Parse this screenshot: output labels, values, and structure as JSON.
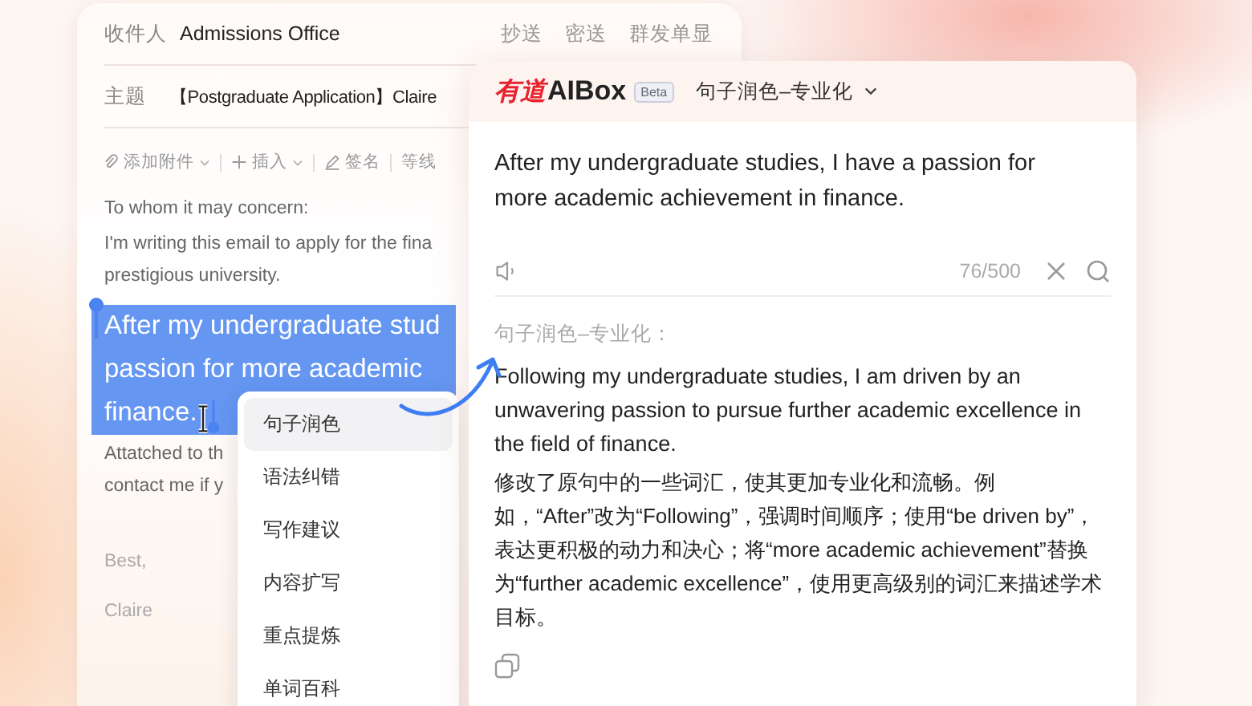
{
  "email": {
    "to_label": "收件人",
    "to": "Admissions Office",
    "header_links": [
      "抄送",
      "密送",
      "群发单显"
    ],
    "subject_label": "主题",
    "subject": "【Postgraduate Application】Claire",
    "toolbar": [
      {
        "kind": "attach",
        "label": "添加附件",
        "dropdown": true
      },
      {
        "kind": "insert",
        "label": "插入",
        "dropdown": true
      },
      {
        "kind": "signature",
        "label": "签名",
        "dropdown": false
      },
      {
        "kind": "font",
        "label": "等线",
        "dropdown": false
      }
    ],
    "body": [
      {
        "text": "To whom it may concern:",
        "selected": false
      },
      {
        "text": "I'm writing this email to apply for the fina",
        "selected": false
      },
      {
        "text": "prestigious university.",
        "selected": false
      },
      {
        "text": "After my undergraduate stud",
        "selected": true
      },
      {
        "text": "passion for more academic",
        "selected": true
      },
      {
        "text": "finance.",
        "selected": true
      },
      {
        "text": "Attatched to th",
        "selected": false
      },
      {
        "text": "contact me if y",
        "selected": false
      }
    ],
    "signoff": [
      "Best,",
      "Claire"
    ]
  },
  "menu": {
    "items": [
      {
        "label": "句子润色",
        "selected": true
      },
      {
        "label": "语法纠错",
        "selected": false
      },
      {
        "label": "写作建议",
        "selected": false
      },
      {
        "label": "内容扩写",
        "selected": false
      },
      {
        "label": "重点提炼",
        "selected": false
      },
      {
        "label": "单词百科",
        "selected": false
      }
    ]
  },
  "panel": {
    "brand_mark": "有道",
    "brand_name": "AIBox",
    "badge": "Beta",
    "mode": "句子润色–专业化",
    "input_text": "After my undergraduate studies, I have a passion for more academic achievement in finance.",
    "counter": "76/500",
    "result_label": "句子润色–专业化：",
    "result_text": "Following my undergraduate studies, I am driven by an unwavering passion to pursue further academic excellence in the field of finance.",
    "result_note": "修改了原句中的一些词汇，使其更加专业化和流畅。例如，“After”改为“Following”，强调时间顺序；使用“be driven by”，表达更积极的动力和决心；将“more academic achievement”替换为“further academic excellence”，使用更高级别的词汇来描述学术目标。"
  }
}
